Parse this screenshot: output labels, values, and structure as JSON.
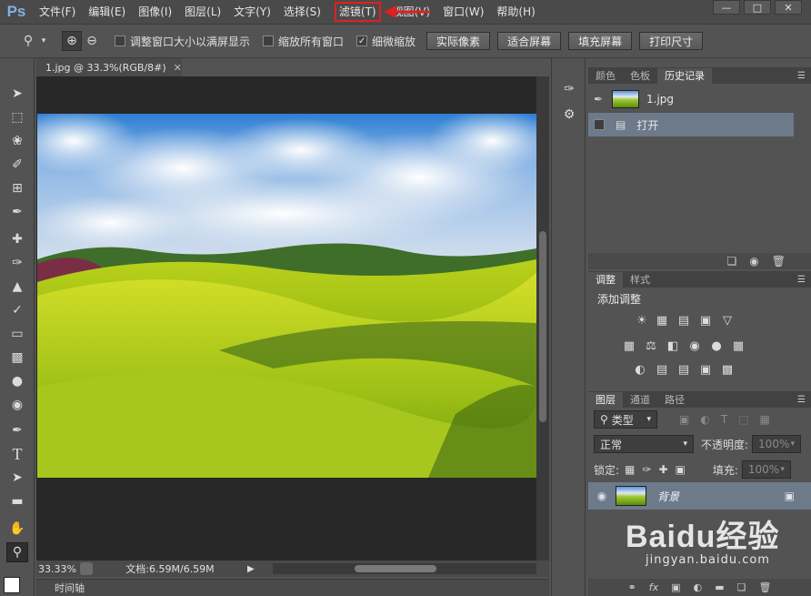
{
  "app": {
    "logo": "Ps"
  },
  "menu": [
    {
      "label": "文件(F)"
    },
    {
      "label": "编辑(E)"
    },
    {
      "label": "图像(I)"
    },
    {
      "label": "图层(L)"
    },
    {
      "label": "文字(Y)"
    },
    {
      "label": "选择(S)"
    },
    {
      "label": "滤镜(T)",
      "highlighted": true
    },
    {
      "label": "视图(V)"
    },
    {
      "label": "窗口(W)"
    },
    {
      "label": "帮助(H)"
    }
  ],
  "window_controls": {
    "minimize": "—",
    "maximize": "□",
    "close": "✕"
  },
  "options": {
    "resize_windows": {
      "label": "调整窗口大小以满屏显示",
      "checked": false
    },
    "zoom_all": {
      "label": "缩放所有窗口",
      "checked": false
    },
    "scrubby_zoom": {
      "label": "细微缩放",
      "checked": true
    },
    "buttons": [
      "实际像素",
      "适合屏幕",
      "填充屏幕",
      "打印尺寸"
    ]
  },
  "document": {
    "tab_title": "1.jpg @ 33.3%(RGB/8#)",
    "zoom": "33.33%",
    "doc_info": "文档:6.59M/6.59M"
  },
  "timeline": {
    "label": "时间轴"
  },
  "history_panel": {
    "tabs": [
      "颜色",
      "色板",
      "历史记录"
    ],
    "active_tab": "历史记录",
    "snapshot": "1.jpg",
    "states": [
      {
        "label": "打开",
        "selected": true
      }
    ]
  },
  "adjust_panel": {
    "tabs": [
      "调整",
      "样式"
    ],
    "active_tab": "调整",
    "title": "添加调整"
  },
  "layers_panel": {
    "tabs": [
      "图层",
      "通道",
      "路径"
    ],
    "active_tab": "图层",
    "filter_kind": "类型",
    "blend_mode": "正常",
    "opacity_label": "不透明度:",
    "opacity_value": "100%",
    "lock_label": "锁定:",
    "fill_label": "填充:",
    "fill_value": "100%",
    "layers": [
      {
        "name": "背景",
        "locked": true,
        "visible": true
      }
    ],
    "footer_icons": [
      "link-icon",
      "fx-icon",
      "mask-icon",
      "adjustment-icon",
      "folder-icon",
      "new-layer-icon",
      "trash-icon"
    ]
  },
  "watermark": {
    "main": "Baidu经验",
    "sub": "jingyan.baidu.com"
  },
  "colors": {
    "highlight": "#e02020",
    "selection": "#6d7a8a",
    "panel": "#535353"
  }
}
